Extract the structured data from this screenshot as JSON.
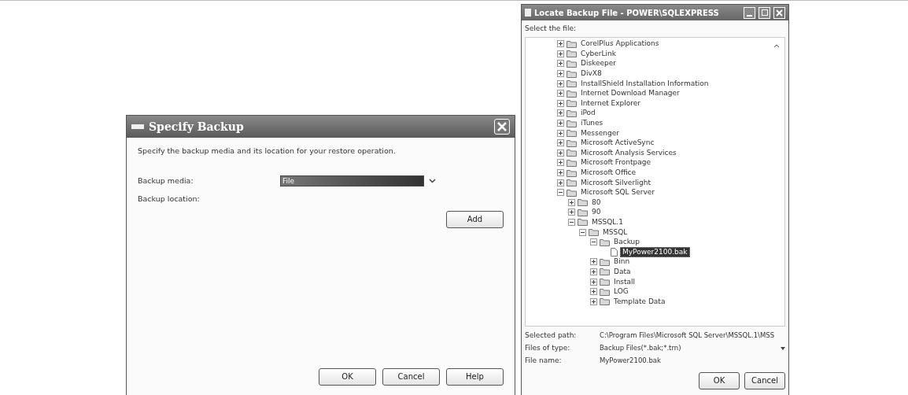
{
  "specify_backup": {
    "title": "Specify Backup",
    "description": "Specify the backup media and its location for your restore operation.",
    "backup_media": {
      "label": "Backup media:",
      "value": "File"
    },
    "backup_location": {
      "label": "Backup location:"
    },
    "add_button": "Add",
    "buttons": [
      "OK",
      "Cancel",
      "Help"
    ]
  },
  "locate_backup_file": {
    "title": "Locate Backup File - POWER\\SQLEXPRESS",
    "prompt": "Select the file:",
    "tree": [
      {
        "label": "CorelPlus Applications",
        "kind": "folder",
        "expanded": false,
        "selected": false
      },
      {
        "label": "CyberLink",
        "kind": "folder",
        "expanded": false,
        "selected": false
      },
      {
        "label": "Diskeeper",
        "kind": "folder",
        "expanded": false,
        "selected": false
      },
      {
        "label": "DivX8",
        "kind": "folder",
        "expanded": false,
        "selected": false
      },
      {
        "label": "InstallShield Installation Information",
        "kind": "folder",
        "expanded": false,
        "selected": false
      },
      {
        "label": "Internet Download Manager",
        "kind": "folder",
        "expanded": false,
        "selected": false
      },
      {
        "label": "Internet Explorer",
        "kind": "folder",
        "expanded": false,
        "selected": false
      },
      {
        "label": "iPod",
        "kind": "folder",
        "expanded": false,
        "selected": false
      },
      {
        "label": "iTunes",
        "kind": "folder",
        "expanded": false,
        "selected": false
      },
      {
        "label": "Messenger",
        "kind": "folder",
        "expanded": false,
        "selected": false
      },
      {
        "label": "Microsoft ActiveSync",
        "kind": "folder",
        "expanded": false,
        "selected": false
      },
      {
        "label": "Microsoft Analysis Services",
        "kind": "folder",
        "expanded": false,
        "selected": false
      },
      {
        "label": "Microsoft Frontpage",
        "kind": "folder",
        "expanded": false,
        "selected": false
      },
      {
        "label": "Microsoft Office",
        "kind": "folder",
        "expanded": false,
        "selected": false
      },
      {
        "label": "Microsoft Silverlight",
        "kind": "folder",
        "expanded": false,
        "selected": false
      },
      {
        "label": "Microsoft SQL Server",
        "kind": "folder",
        "expanded": true,
        "selected": false,
        "children": [
          {
            "label": "80",
            "kind": "folder",
            "expanded": false,
            "selected": false
          },
          {
            "label": "90",
            "kind": "folder",
            "expanded": false,
            "selected": false
          },
          {
            "label": "MSSQL.1",
            "kind": "folder",
            "expanded": true,
            "selected": false,
            "children": [
              {
                "label": "MSSQL",
                "kind": "folder",
                "expanded": true,
                "selected": false,
                "children": [
                  {
                    "label": "Backup",
                    "kind": "folder",
                    "expanded": true,
                    "selected": false,
                    "children": [
                      {
                        "label": "MyPower2100.bak",
                        "kind": "file",
                        "selected": true
                      }
                    ]
                  },
                  {
                    "label": "Binn",
                    "kind": "folder",
                    "expanded": false,
                    "selected": false
                  },
                  {
                    "label": "Data",
                    "kind": "folder",
                    "expanded": false,
                    "selected": false
                  },
                  {
                    "label": "Install",
                    "kind": "folder",
                    "expanded": false,
                    "selected": false
                  },
                  {
                    "label": "LOG",
                    "kind": "folder",
                    "expanded": false,
                    "selected": false
                  },
                  {
                    "label": "Template Data",
                    "kind": "folder",
                    "expanded": false,
                    "selected": false
                  }
                ]
              }
            ]
          }
        ]
      }
    ],
    "fields": [
      {
        "label": "Selected path:",
        "value": "C:\\Program Files\\Microsoft SQL Server\\MSSQL.1\\MSS",
        "kind": "text"
      },
      {
        "label": "Files of type:",
        "value": "Backup Files(*.bak;*.trn)",
        "kind": "dropdown"
      },
      {
        "label": "File name:",
        "value": "MyPower2100.bak",
        "kind": "text"
      }
    ],
    "buttons": [
      "OK",
      "Cancel"
    ]
  }
}
